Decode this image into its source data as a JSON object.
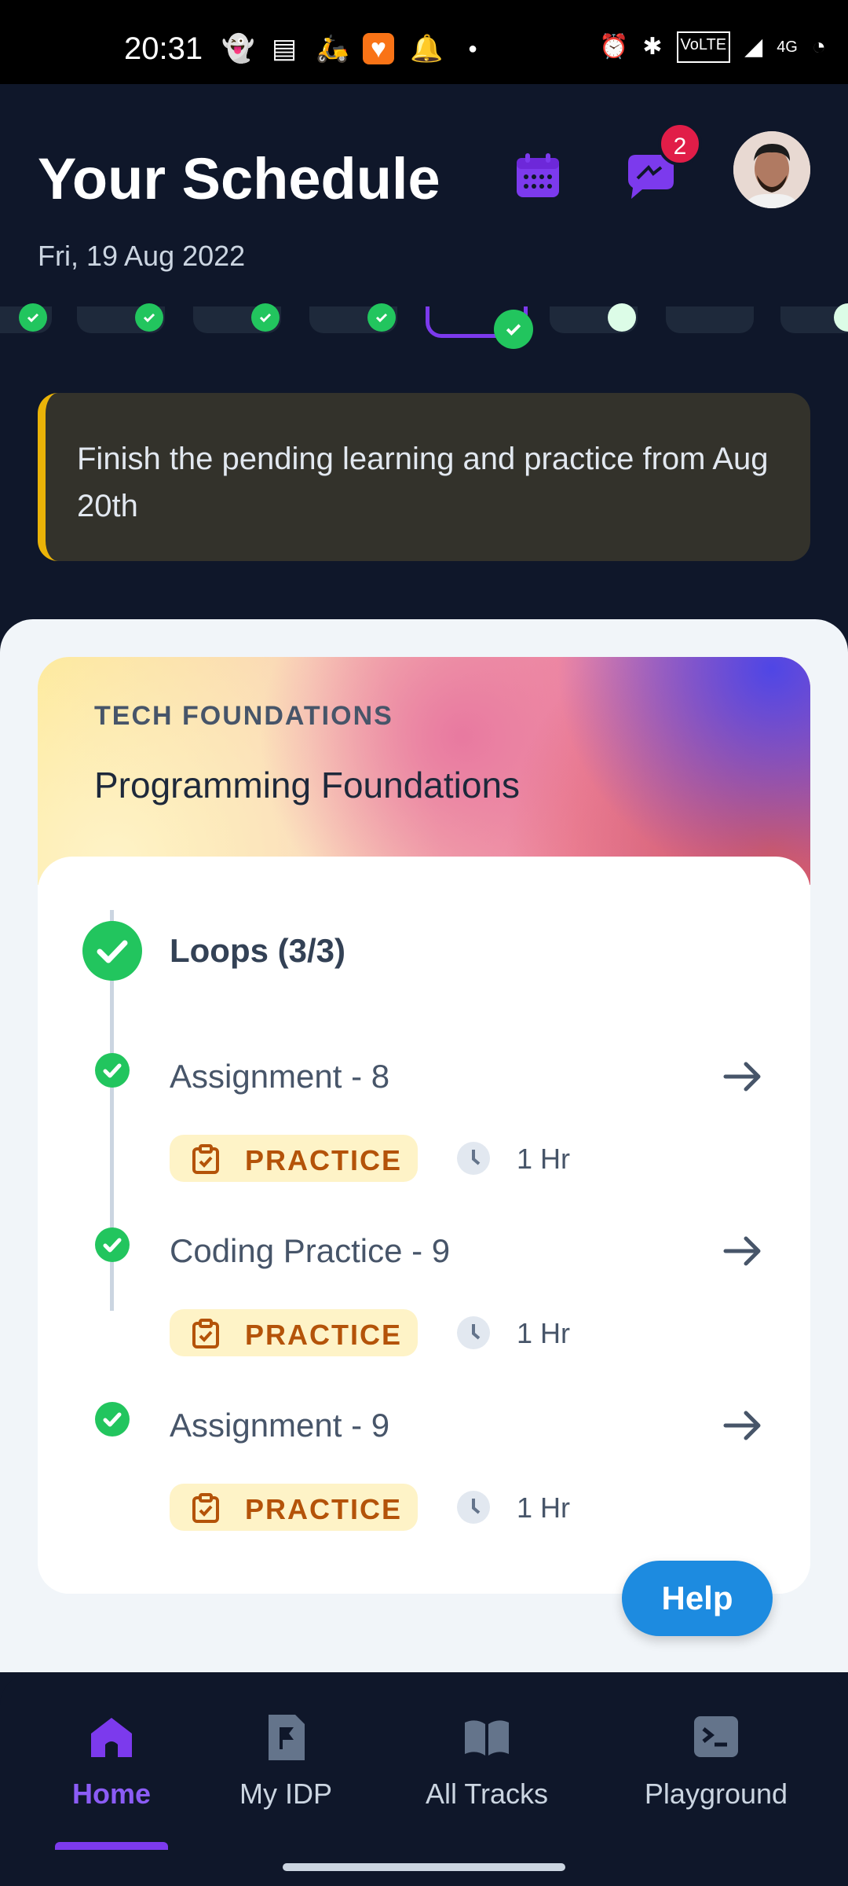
{
  "status_bar": {
    "time": "20:31",
    "icons": [
      "snapchat-icon",
      "news-icon",
      "scooter-icon",
      "heart-app-icon",
      "bell-icon",
      "dot-icon",
      "alarm-icon",
      "bluetooth-icon",
      "volte-icon",
      "signal-icon",
      "4g-icon",
      "battery-icon"
    ]
  },
  "header": {
    "title": "Your Schedule",
    "date": "Fri, 19 Aug 2022",
    "notification_count": "2"
  },
  "banner": {
    "text": "Finish the pending learning and practice from Aug 20th"
  },
  "course": {
    "category": "TECH FOUNDATIONS",
    "title": "Programming Foundations",
    "module": {
      "title": "Loops (3/3)",
      "items": [
        {
          "title": "Assignment - 8",
          "tag": "PRACTICE",
          "duration": "1 Hr"
        },
        {
          "title": "Coding Practice - 9",
          "tag": "PRACTICE",
          "duration": "1 Hr"
        },
        {
          "title": "Assignment - 9",
          "tag": "PRACTICE",
          "duration": "1 Hr"
        }
      ]
    }
  },
  "help_button": "Help",
  "bottom_nav": {
    "items": [
      {
        "label": "Home",
        "icon": "home-icon",
        "active": true
      },
      {
        "label": "My IDP",
        "icon": "flag-document-icon",
        "active": false
      },
      {
        "label": "All Tracks",
        "icon": "open-book-icon",
        "active": false
      },
      {
        "label": "Playground",
        "icon": "terminal-icon",
        "active": false
      }
    ]
  },
  "colors": {
    "background": "#0f172a",
    "accent": "#7c3aed",
    "success": "#22c55e",
    "warning": "#eab308",
    "help": "#1d8be0"
  }
}
